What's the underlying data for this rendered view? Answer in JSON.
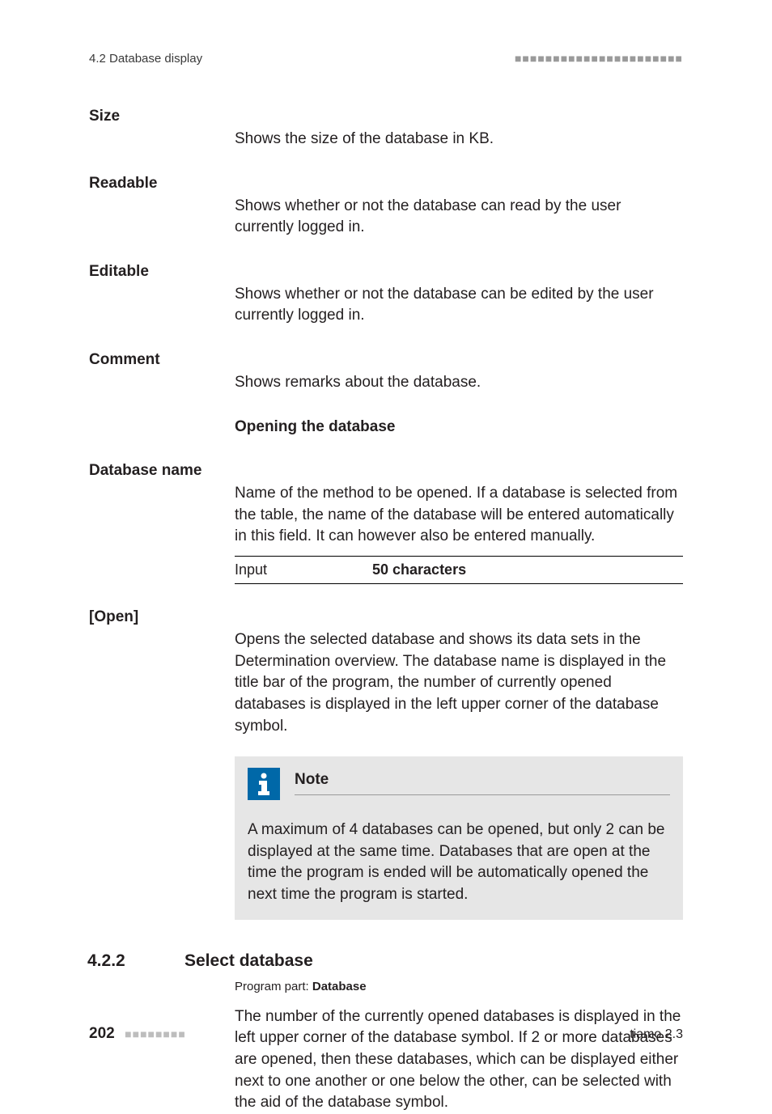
{
  "header": {
    "section": "4.2 Database display"
  },
  "terms": {
    "size": {
      "label": "Size",
      "desc": "Shows the size of the database in KB."
    },
    "readable": {
      "label": "Readable",
      "desc": "Shows whether or not the database can read by the user currently logged in."
    },
    "editable": {
      "label": "Editable",
      "desc": "Shows whether or not the database can be edited by the user currently logged in."
    },
    "comment": {
      "label": "Comment",
      "desc": "Shows remarks about the database."
    }
  },
  "subheading_open": "Opening the database",
  "dbname": {
    "label": "Database name",
    "desc": "Name of the method to be opened. If a database is selected from the table, the name of the database will be entered automatically in this field. It can however also be entered manually.",
    "input_label": "Input",
    "input_value": "50 characters"
  },
  "open": {
    "label": "[Open]",
    "desc": "Opens the selected database and shows its data sets in the Determination overview. The database name is displayed in the title bar of the program, the number of currently opened databases is displayed in the left upper corner of the database symbol.",
    "note_title": "Note",
    "note_body": "A maximum of 4 databases can be opened, but only 2 can be displayed at the same time. Databases that are open at the time the program is ended will be automatically opened the next time the program is started."
  },
  "h2": {
    "num": "4.2.2",
    "title": "Select database"
  },
  "program_part": {
    "label": "Program part: ",
    "value": "Database"
  },
  "select_db_body": "The number of the currently opened databases is displayed in the left upper corner of the database symbol. If 2 or more databases are opened, then these databases, which can be displayed either next to one another or one below the other, can be selected with the aid of the database symbol.",
  "footer": {
    "page": "202",
    "product": "tiamo 2.3"
  }
}
